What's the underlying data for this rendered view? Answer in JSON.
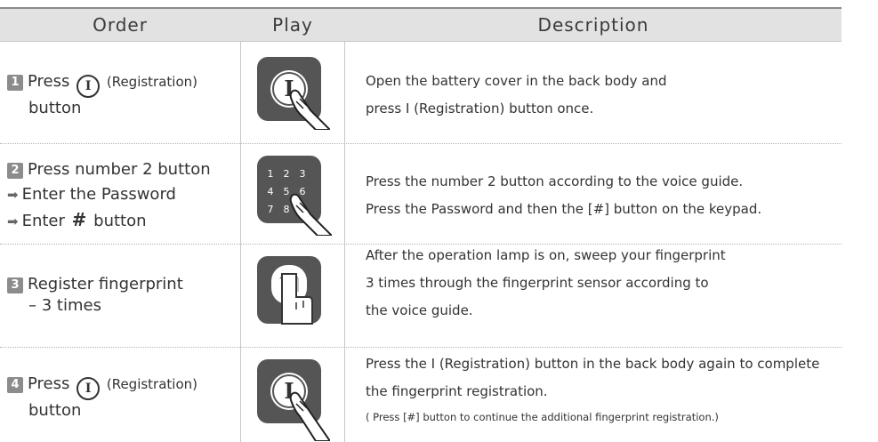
{
  "header": {
    "order": "Order",
    "play": "Play",
    "description": "Description"
  },
  "rows": [
    {
      "step": "1",
      "order_line1_prefix": "Press",
      "order_line1_symbol": "I",
      "order_line1_suffix": "(Registration)",
      "order_line2": "button",
      "icon": "registration-button-press-icon",
      "desc_lines": [
        "Open the battery cover in the back body and",
        "press Ⅰ (Registration) button once."
      ]
    },
    {
      "step": "2",
      "order_line1": "Press number 2 button",
      "order_line2": "Enter the Password",
      "order_line3_prefix": "Enter",
      "order_line3_symbol": "#",
      "order_line3_suffix": "button",
      "icon": "keypad-press-icon",
      "keypad_keys": [
        "1",
        "2",
        "3",
        "4",
        "5",
        "6",
        "7",
        "8"
      ],
      "desc_lines": [
        "Press the number 2 button according to the voice guide.",
        "Press the Password and then the [#] button on the keypad."
      ]
    },
    {
      "step": "3",
      "order_line1": "Register fingerprint",
      "order_line2": "– 3 times",
      "icon": "fingerprint-sweep-icon",
      "desc_lines": [
        "After the operation lamp is on, sweep your fingerprint",
        "3 times through the fingerprint sensor according to",
        "the voice guide."
      ]
    },
    {
      "step": "4",
      "order_line1_prefix": "Press",
      "order_line1_symbol": "I",
      "order_line1_suffix": "(Registration)",
      "order_line2": "button",
      "icon": "registration-button-press-icon",
      "desc_lines": [
        "Press the Ⅰ (Registration) button in the back body again to complete",
        "the fingerprint registration."
      ],
      "desc_note": "( Press [#] button to continue the additional fingerprint registration.)"
    }
  ],
  "colors": {
    "header_bg": "#e2e2e2",
    "icon_bg": "#555555",
    "step_badge": "#8c8c8c"
  }
}
